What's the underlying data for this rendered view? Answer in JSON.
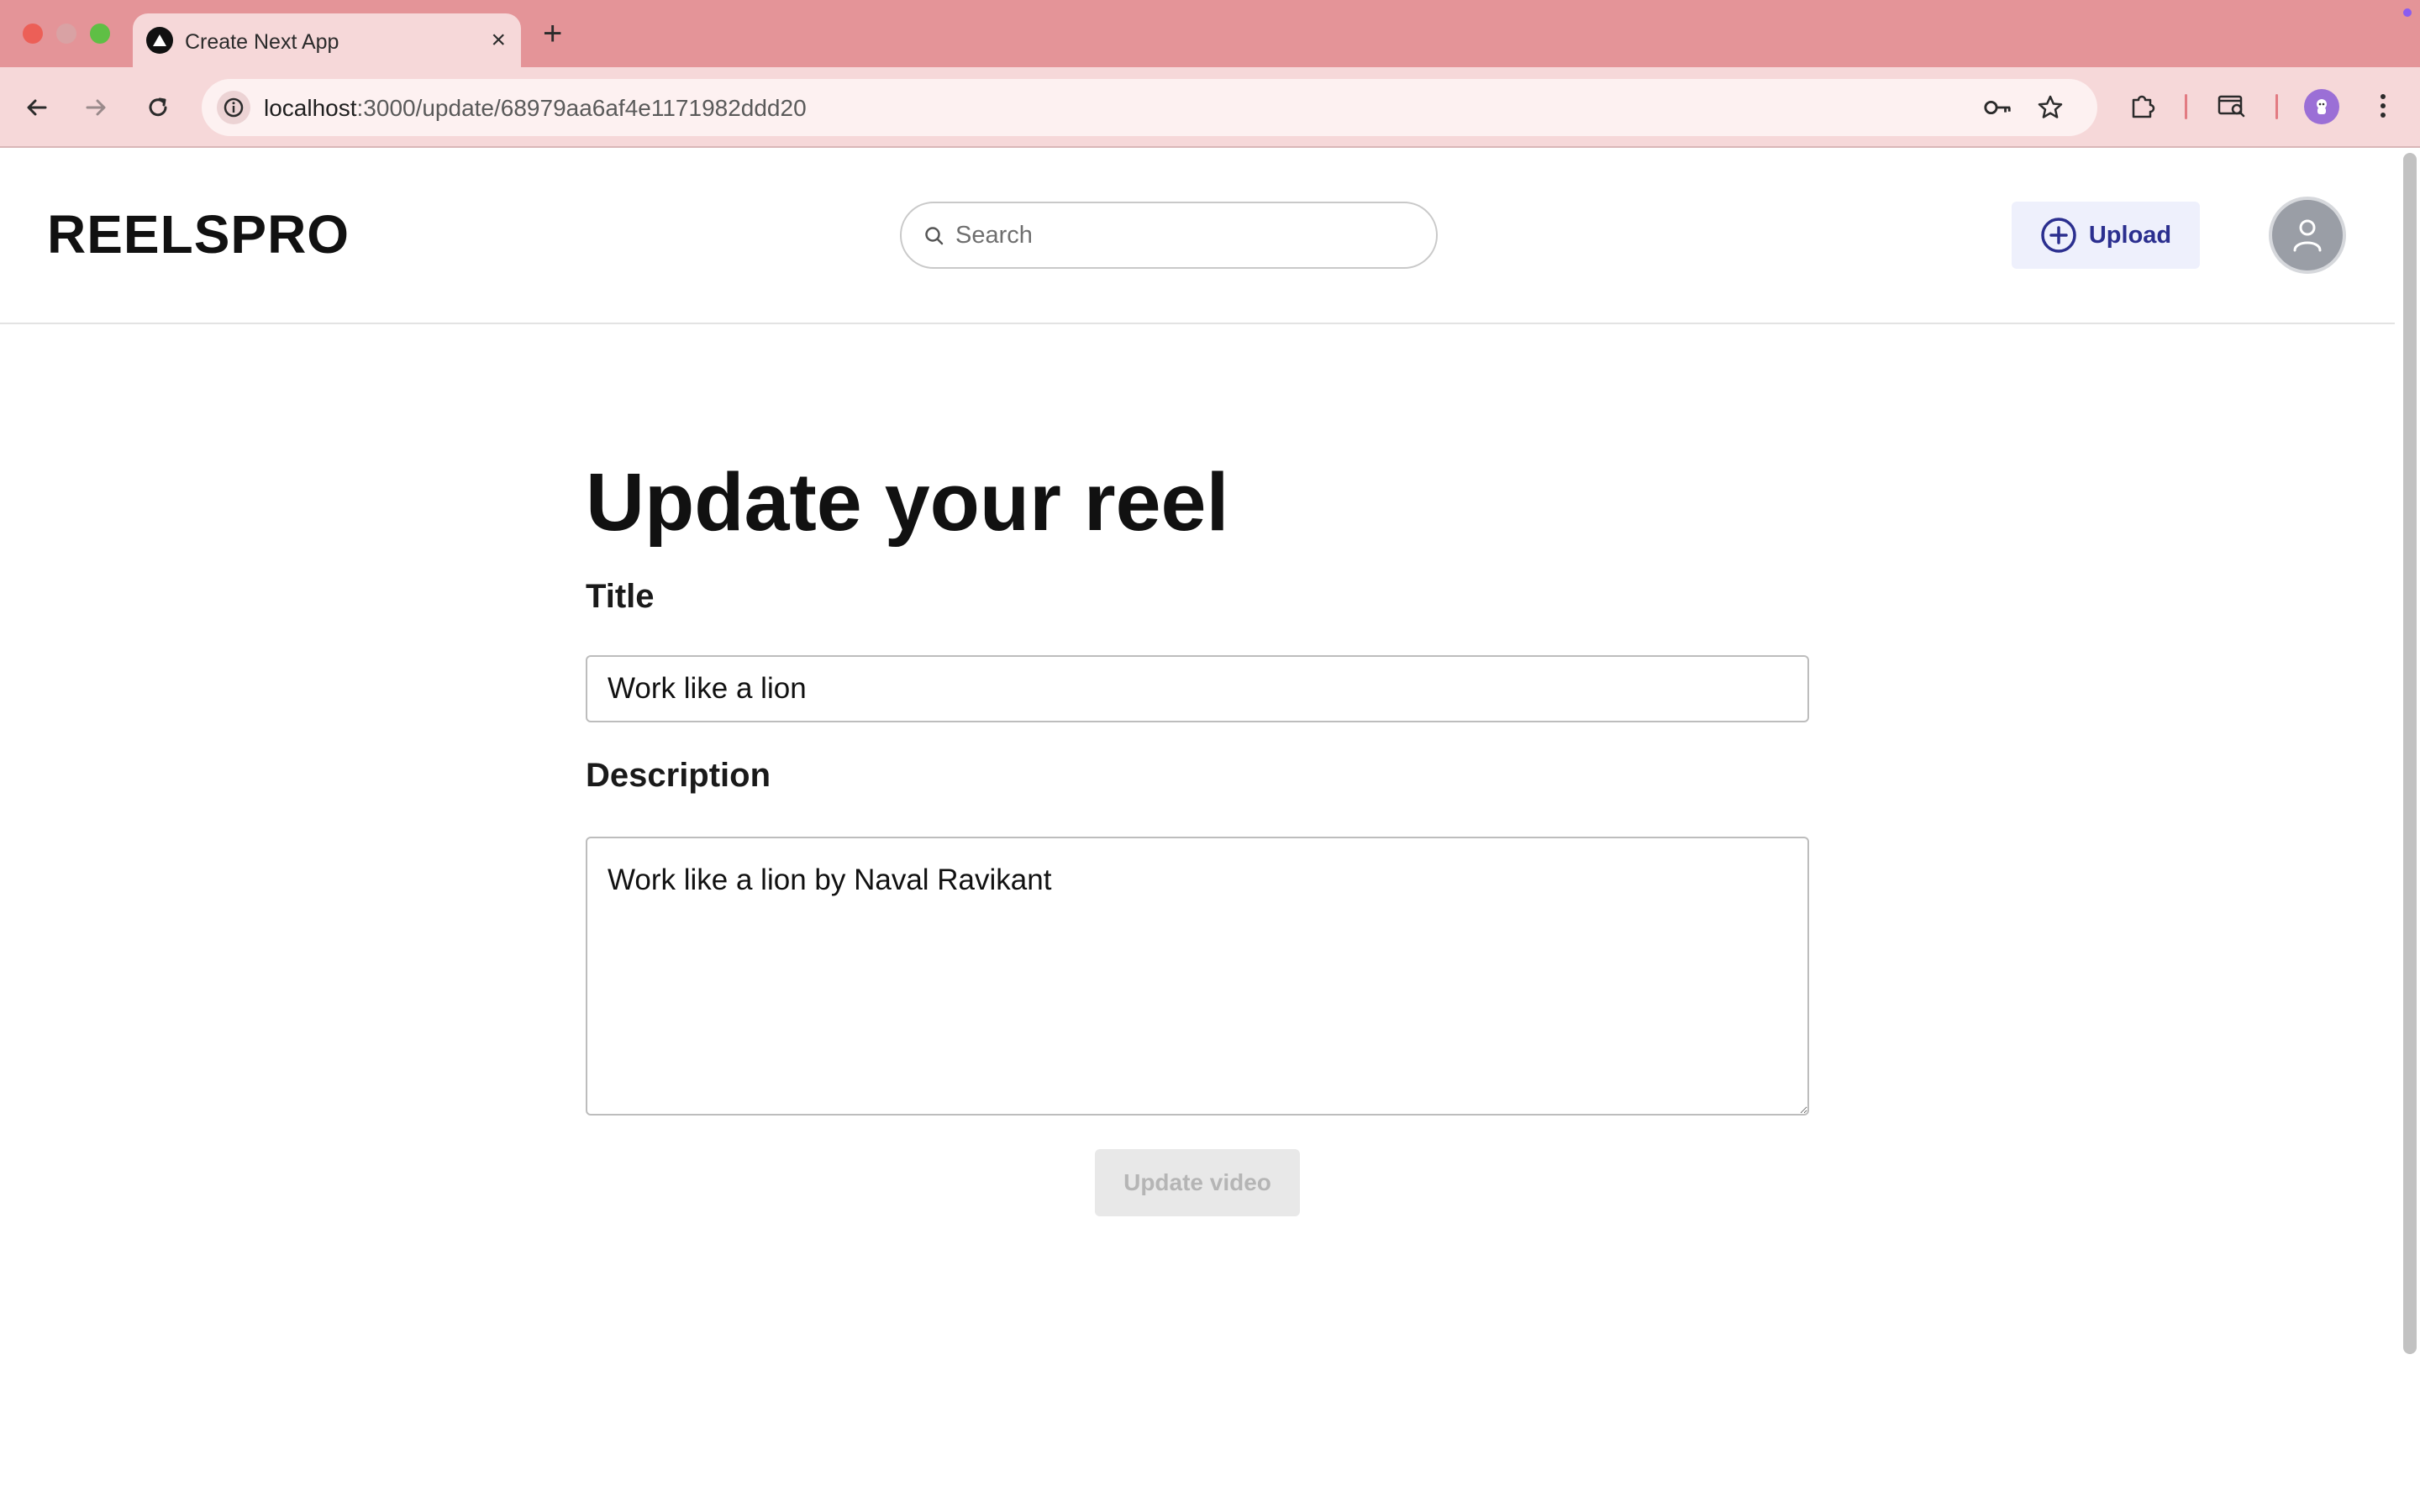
{
  "browser": {
    "tab_title": "Create Next App",
    "new_tab_symbol": "+",
    "close_symbol": "×",
    "url_host": "localhost",
    "url_path": ":3000/update/68979aa6af4e1171982ddd20",
    "accent_color": "#e49498"
  },
  "app": {
    "logo": "REELSPRO",
    "search": {
      "placeholder": "Search",
      "value": ""
    },
    "upload_label": "Upload"
  },
  "form": {
    "heading": "Update your reel",
    "title_label": "Title",
    "title_value": "Work like a lion",
    "description_label": "Description",
    "description_value": "Work like a lion by Naval Ravikant",
    "submit_label": "Update video",
    "submit_disabled": true
  },
  "icons": {
    "tab_favicon": "triangle-logo-icon",
    "back": "arrow-left-icon",
    "forward": "arrow-right-icon",
    "reload": "reload-icon",
    "site_info": "info-icon",
    "password": "key-icon",
    "bookmark": "star-icon",
    "extensions": "puzzle-icon",
    "tab_search": "tab-search-icon",
    "menu": "kebab-menu-icon",
    "search": "search-icon",
    "upload": "plus-circle-icon",
    "avatar": "user-icon"
  }
}
